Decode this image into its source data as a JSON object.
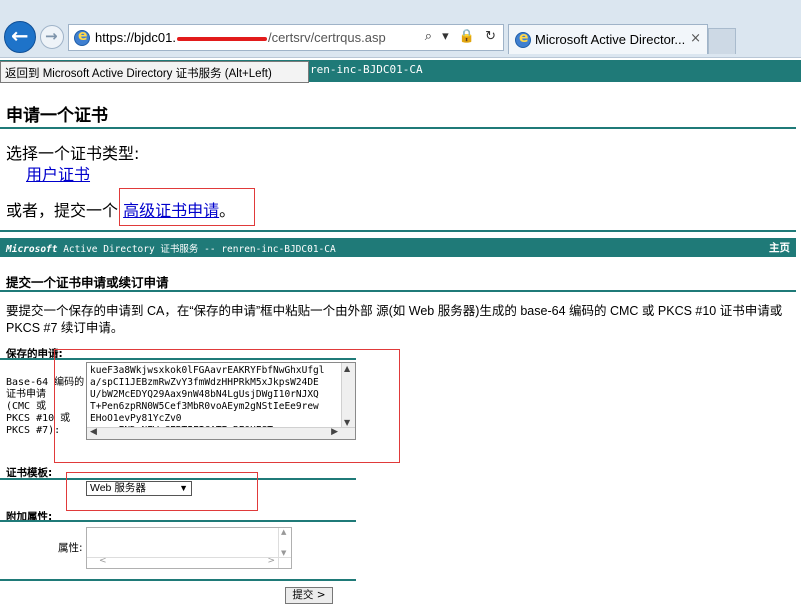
{
  "browser": {
    "url_host": "https://bjdc01.",
    "url_path": "/certsrv/certrqus.asp",
    "url_tools": "⌕ ▾ 🔒 ↻",
    "tab_title": "Microsoft Active Director...",
    "tab_close": "×"
  },
  "tooltip": "返回到 Microsoft Active Directory 证书服务 (Alt+Left)",
  "top_banner_text": "ren-inc-BJDC01-CA",
  "page1": {
    "title": "申请一个证书",
    "choose_label": "选择一个证书类型:",
    "user_cert_link": "用户证书",
    "or_prefix": "或者，提交一个 ",
    "advanced_link": "高级证书申请",
    "or_suffix": "。"
  },
  "page2": {
    "banner_ms": "Microsoft",
    "banner_rest": " Active Directory 证书服务  --  renren-inc-BJDC01-CA",
    "home_link": "主页",
    "title": "提交一个证书申请或续订申请",
    "description": "要提交一个保存的申请到 CA，在“保存的申请”框中粘贴一个由外部 源(如 Web 服务器)生成的 base-64 编码的 CMC 或 PKCS #10 证书申请或 PKCS #7 续订申请。",
    "saved_request_label": "保存的申请:",
    "request_field_label": "Base-64 编码的\n证书申请\n(CMC 或\nPKCS #10 或\nPKCS #7):",
    "request_text": "kueF3a8Wkjwsxkok0lFGAavrEAKRYFbfNwGhxUfgl\na/spCI1JEBzmRwZvY3fmWdzHHPRkM5xJkpsW24DE\nU/bW2McEDYQ29Aax9nW48bN4LgUsjDWgI10rNJXQ\nT+Pen6zpRN0W5Cef3MbR0voAEym2gNStIeEe9rew\nEHoO1evPy81YcZv0\n-----END NEW CERTIFICATE REQUEST-----",
    "template_label": "证书模板:",
    "template_selected": "Web 服务器",
    "extra_attr_label": "附加属性:",
    "attr_label": "属性:",
    "attr_value": "",
    "submit_label": "提交 >"
  },
  "colors": {
    "banner": "#1f7a78",
    "link": "#0000cc",
    "highlight_box": "#e03a3a",
    "redaction": "#e21b1b"
  }
}
